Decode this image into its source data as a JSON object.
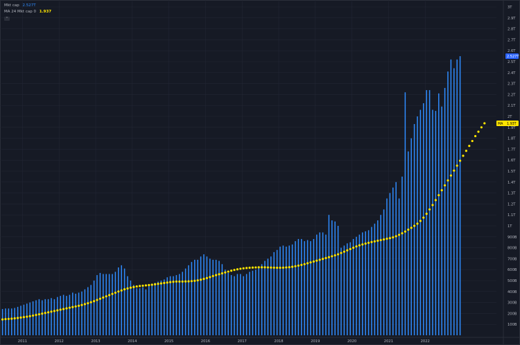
{
  "legend": {
    "series1_name": "Mkt cap",
    "series1_value": "2.527T",
    "series2_name": "MA 24 Mkt cap 0",
    "series2_value": "1.937",
    "toggle_icon": "chevron-up-icon"
  },
  "colors": {
    "background": "#161a25",
    "grid": "#222634",
    "bars": "#2f8cff",
    "ma_dots": "#ffe500",
    "axis_text": "#b2b5be"
  },
  "price_labels": {
    "last_value": "2.527T",
    "ma_tag": "MA",
    "ma_value": "1.93T"
  },
  "chart_data": {
    "type": "bar",
    "title": "",
    "series": [
      {
        "name": "Mkt cap",
        "style": "bars",
        "start": "2010-06",
        "interval": "month",
        "values": [
          240,
          245,
          245,
          245,
          250,
          260,
          270,
          280,
          290,
          300,
          310,
          320,
          330,
          320,
          330,
          330,
          340,
          330,
          350,
          360,
          370,
          360,
          370,
          390,
          380,
          390,
          400,
          420,
          440,
          460,
          500,
          550,
          570,
          560,
          560,
          560,
          560,
          580,
          620,
          640,
          610,
          540,
          500,
          460,
          430,
          430,
          440,
          420,
          450,
          460,
          480,
          490,
          500,
          510,
          530,
          540,
          540,
          550,
          560,
          580,
          610,
          640,
          670,
          690,
          690,
          720,
          740,
          720,
          700,
          690,
          690,
          680,
          650,
          600,
          570,
          550,
          540,
          560,
          560,
          540,
          560,
          580,
          590,
          600,
          620,
          650,
          680,
          700,
          720,
          760,
          780,
          810,
          820,
          810,
          820,
          830,
          860,
          880,
          880,
          860,
          870,
          860,
          880,
          920,
          940,
          940,
          920,
          1100,
          1050,
          1040,
          1000,
          800,
          820,
          840,
          850,
          880,
          900,
          920,
          940,
          950,
          960,
          990,
          1020,
          1050,
          1100,
          1150,
          1250,
          1300,
          1350,
          1400,
          1250,
          1450,
          2220,
          1680,
          1800,
          1930,
          2000,
          2060,
          2120,
          2240,
          2240,
          2060,
          2050,
          2210,
          2090,
          2260,
          2410,
          2520,
          2440,
          2520,
          2550
        ],
        "visible_ticks": []
      },
      {
        "name": "MA 24 Mkt cap 0",
        "style": "dots",
        "start": "2010-06",
        "interval": "month",
        "values": [
          145,
          148,
          150,
          152,
          155,
          158,
          162,
          166,
          170,
          175,
          180,
          186,
          192,
          198,
          204,
          210,
          216,
          222,
          228,
          234,
          240,
          246,
          252,
          258,
          264,
          270,
          277,
          285,
          293,
          302,
          312,
          323,
          334,
          345,
          356,
          367,
          378,
          389,
          400,
          410,
          420,
          428,
          435,
          441,
          446,
          450,
          453,
          456,
          459,
          462,
          466,
          470,
          474,
          478,
          482,
          486,
          489,
          491,
          491,
          491,
          492,
          493,
          495,
          498,
          502,
          508,
          515,
          523,
          532,
          541,
          550,
          558,
          566,
          574,
          582,
          590,
          597,
          603,
          608,
          612,
          615,
          617,
          619,
          620,
          621,
          621,
          621,
          620,
          619,
          618,
          617,
          617,
          618,
          620,
          622,
          626,
          631,
          637,
          643,
          650,
          658,
          666,
          674,
          682,
          690,
          698,
          706,
          714,
          722,
          730,
          740,
          752,
          764,
          776,
          788,
          800,
          812,
          822,
          830,
          838,
          845,
          852,
          858,
          864,
          870,
          876,
          882,
          888,
          895,
          905,
          918,
          932,
          948,
          965,
          982,
          1000,
          1020,
          1045,
          1075,
          1110,
          1150,
          1190,
          1235,
          1280,
          1325,
          1370,
          1415,
          1460,
          1505,
          1550,
          1595,
          1640,
          1685,
          1730,
          1775,
          1820,
          1860,
          1900,
          1937
        ]
      }
    ],
    "x_axis": {
      "type": "date",
      "ticks": [
        "2011",
        "2012",
        "2013",
        "2014",
        "2015",
        "2016",
        "2017",
        "2018",
        "2019",
        "2020",
        "2021",
        "2022"
      ]
    },
    "y_axis": {
      "position": "right",
      "units": "billions",
      "range": [
        0,
        2650
      ],
      "ticks": [
        {
          "value": 100,
          "label": "100B"
        },
        {
          "value": 200,
          "label": "200B"
        },
        {
          "value": 300,
          "label": "300B"
        },
        {
          "value": 400,
          "label": "400B"
        },
        {
          "value": 500,
          "label": "500B"
        },
        {
          "value": 600,
          "label": "600B"
        },
        {
          "value": 700,
          "label": "700B"
        },
        {
          "value": 800,
          "label": "800B"
        },
        {
          "value": 900,
          "label": "900B"
        },
        {
          "value": 1000,
          "label": "1T"
        },
        {
          "value": 1100,
          "label": "1.1T"
        },
        {
          "value": 1200,
          "label": "1.2T"
        },
        {
          "value": 1300,
          "label": "1.3T"
        },
        {
          "value": 1400,
          "label": "1.4T"
        },
        {
          "value": 1500,
          "label": "1.5T"
        },
        {
          "value": 1600,
          "label": "1.6T"
        },
        {
          "value": 1700,
          "label": "1.7T"
        },
        {
          "value": 1800,
          "label": "1.8T"
        },
        {
          "value": 1900,
          "label": "1.9T"
        },
        {
          "value": 2000,
          "label": "2T"
        },
        {
          "value": 2100,
          "label": "2.1T"
        },
        {
          "value": 2200,
          "label": "2.2T"
        },
        {
          "value": 2300,
          "label": "2.3T"
        },
        {
          "value": 2400,
          "label": "2.4T"
        },
        {
          "value": 2500,
          "label": "2.5T"
        },
        {
          "value": 2600,
          "label": "2.6T"
        },
        {
          "value": 2700,
          "label": "2.7T"
        },
        {
          "value": 2800,
          "label": "2.8T"
        },
        {
          "value": 2900,
          "label": "2.9T"
        },
        {
          "value": 3000,
          "label": "3T"
        }
      ]
    },
    "grid": true,
    "legend_position": "top-left"
  }
}
